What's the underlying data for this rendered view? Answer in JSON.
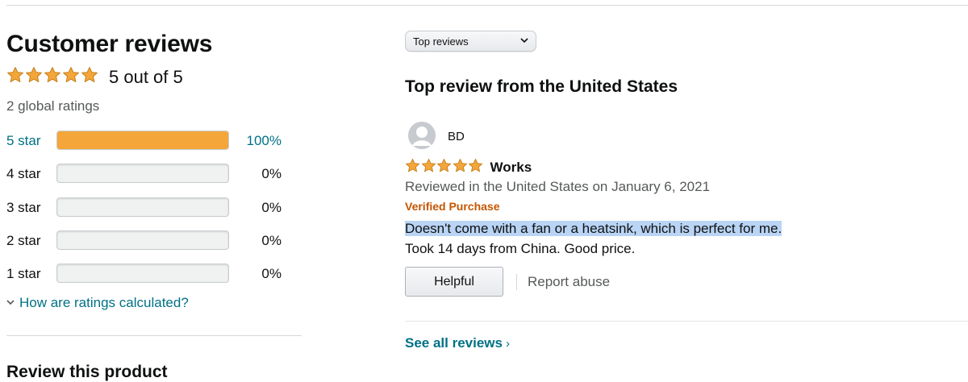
{
  "summary": {
    "title": "Customer reviews",
    "average_text": "5 out of 5",
    "rating_value": 5,
    "rating_max": 5,
    "global_ratings": "2 global ratings",
    "histogram": [
      {
        "label": "5 star",
        "percent_text": "100%",
        "percent": 100,
        "active": true
      },
      {
        "label": "4 star",
        "percent_text": "0%",
        "percent": 0,
        "active": false
      },
      {
        "label": "3 star",
        "percent_text": "0%",
        "percent": 0,
        "active": false
      },
      {
        "label": "2 star",
        "percent_text": "0%",
        "percent": 0,
        "active": false
      },
      {
        "label": "1 star",
        "percent_text": "0%",
        "percent": 0,
        "active": false
      }
    ],
    "how_calculated": "How are ratings calculated?",
    "review_product_heading": "Review this product"
  },
  "reviews": {
    "sort_selected": "Top reviews",
    "section_heading": "Top review from the United States",
    "top_review": {
      "reviewer": "BD",
      "rating_value": 5,
      "title": "Works",
      "date_line": "Reviewed in the United States on January 6, 2021",
      "verified": "Verified Purchase",
      "body_line1": "Doesn't come with a fan or a heatsink, which is perfect for me.",
      "body_line2": "Took 14 days from China. Good price.",
      "helpful_label": "Helpful",
      "report_label": "Report abuse"
    },
    "see_all": "See all reviews",
    "see_all_chevron": "›"
  },
  "colors": {
    "star": "#f4a63a",
    "link": "#007185",
    "verified": "#c45500",
    "highlight": "#b9d4f4"
  }
}
